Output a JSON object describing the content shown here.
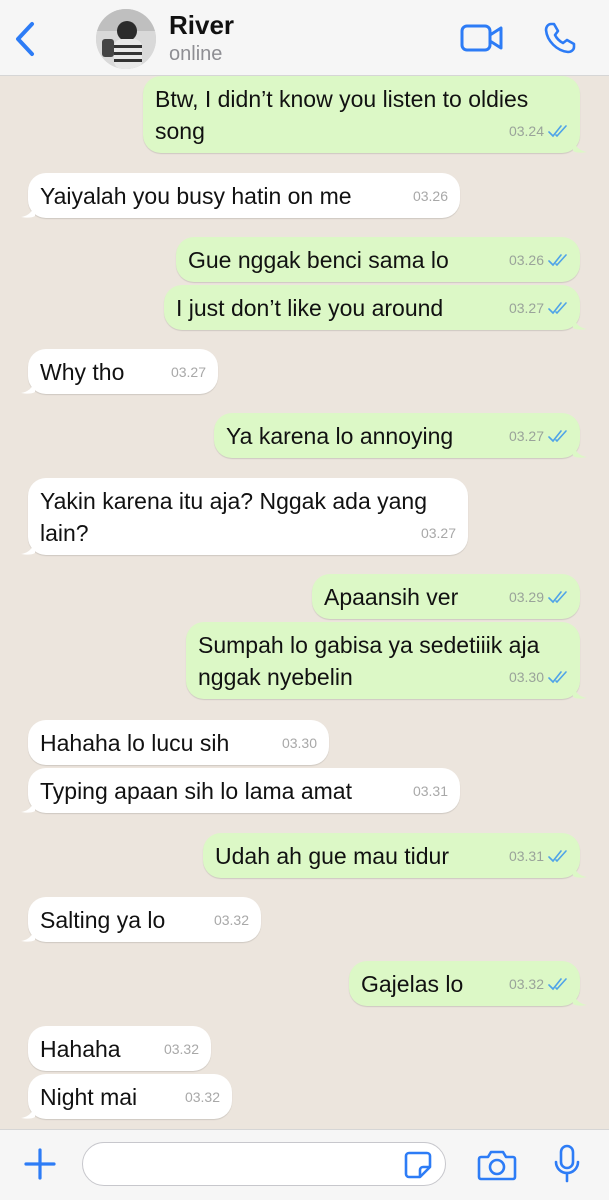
{
  "header": {
    "contact_name": "River",
    "status": "online",
    "back_icon": "chevron-left-icon",
    "video_icon": "video-camera-icon",
    "call_icon": "phone-icon",
    "accent_color": "#2D7CF6"
  },
  "messages": [
    {
      "dir": "out",
      "text": "Btw, I didn’t know you listen to oldies\nsong",
      "time": "03.24",
      "read": true
    },
    {
      "dir": "in",
      "text": "Yaiyalah you busy hatin on me",
      "time": "03.26"
    },
    {
      "dir": "out",
      "text": "Gue nggak benci sama lo",
      "time": "03.26",
      "read": true
    },
    {
      "dir": "out",
      "text": "I just don’t like you around",
      "time": "03.27",
      "read": true
    },
    {
      "dir": "in",
      "text": "Why tho",
      "time": "03.27"
    },
    {
      "dir": "out",
      "text": "Ya karena lo annoying",
      "time": "03.27",
      "read": true
    },
    {
      "dir": "in",
      "text": "Yakin karena itu aja? Nggak ada yang\nlain?",
      "time": "03.27"
    },
    {
      "dir": "out",
      "text": "Apaansih ver",
      "time": "03.29",
      "read": true
    },
    {
      "dir": "out",
      "text": "Sumpah lo gabisa ya sedetiiik aja\nnggak nyebelin",
      "time": "03.30",
      "read": true
    },
    {
      "dir": "in",
      "text": "Hahaha lo lucu sih",
      "time": "03.30"
    },
    {
      "dir": "in",
      "text": "Typing apaan sih lo lama amat",
      "time": "03.31"
    },
    {
      "dir": "out",
      "text": "Udah ah gue mau tidur",
      "time": "03.31",
      "read": true
    },
    {
      "dir": "in",
      "text": "Salting ya lo",
      "time": "03.32"
    },
    {
      "dir": "out",
      "text": "Gajelas lo",
      "time": "03.32",
      "read": true
    },
    {
      "dir": "in",
      "text": "Hahaha",
      "time": "03.32"
    },
    {
      "dir": "in",
      "text": "Night mai",
      "time": "03.32"
    }
  ],
  "composer": {
    "value": "",
    "plus_icon": "plus-icon",
    "sticker_icon": "sticker-icon",
    "camera_icon": "camera-icon",
    "mic_icon": "microphone-icon"
  },
  "colors": {
    "background": "#ECE5DD",
    "incoming_bubble": "#FFFFFF",
    "outgoing_bubble": "#DCF8C6",
    "read_ticks": "#4FA3E8"
  }
}
